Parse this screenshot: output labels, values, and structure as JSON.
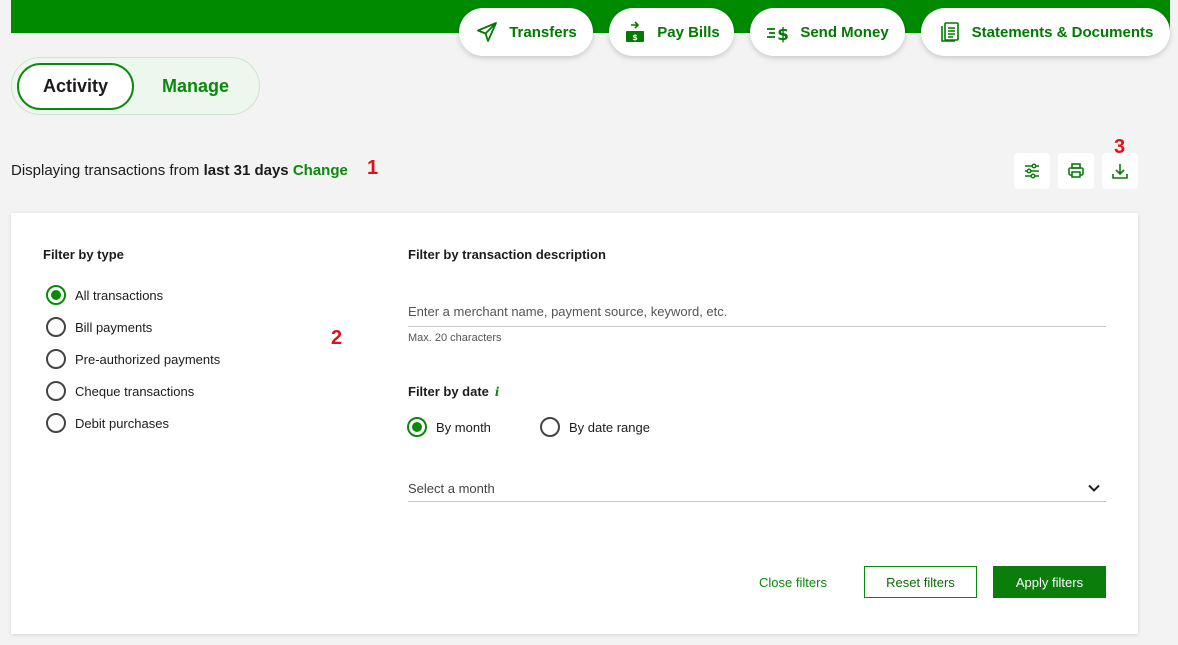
{
  "quick_actions": {
    "transfers": {
      "label": "Transfers",
      "icon": "paper-plane-icon"
    },
    "pay_bills": {
      "label": "Pay Bills",
      "icon": "bill-cash-icon"
    },
    "send_money": {
      "label": "Send Money",
      "icon": "dollar-send-icon"
    },
    "statements": {
      "label": "Statements & Documents",
      "icon": "document-icon"
    }
  },
  "view_toggle": {
    "active": "Activity",
    "inactive": "Manage"
  },
  "display": {
    "prefix": "Displaying transactions from",
    "range": "last 31 days",
    "change_link": "Change"
  },
  "markers": {
    "m1": "1",
    "m2": "2",
    "m3": "3"
  },
  "toolbar": {
    "filter_icon": "sliders-icon",
    "print_icon": "printer-icon",
    "download_icon": "download-icon"
  },
  "filters": {
    "type_title": "Filter by type",
    "types": [
      {
        "label": "All transactions",
        "checked": true
      },
      {
        "label": "Bill payments",
        "checked": false
      },
      {
        "label": "Pre-authorized payments",
        "checked": false
      },
      {
        "label": "Cheque transactions",
        "checked": false
      },
      {
        "label": "Debit purchases",
        "checked": false
      }
    ],
    "desc_title": "Filter by transaction description",
    "desc_placeholder": "Enter a merchant name, payment source, keyword, etc.",
    "desc_helper": "Max. 20 characters",
    "date_title": "Filter by date",
    "date_info": "i",
    "date_modes": [
      {
        "label": "By month",
        "checked": true
      },
      {
        "label": "By date range",
        "checked": false
      }
    ],
    "month_placeholder": "Select a month"
  },
  "actions": {
    "close": "Close filters",
    "reset": "Reset filters",
    "apply": "Apply filters"
  },
  "colors": {
    "brand_green": "#008a00",
    "link_green": "#0a8a0a",
    "marker_red": "#e0101a"
  }
}
